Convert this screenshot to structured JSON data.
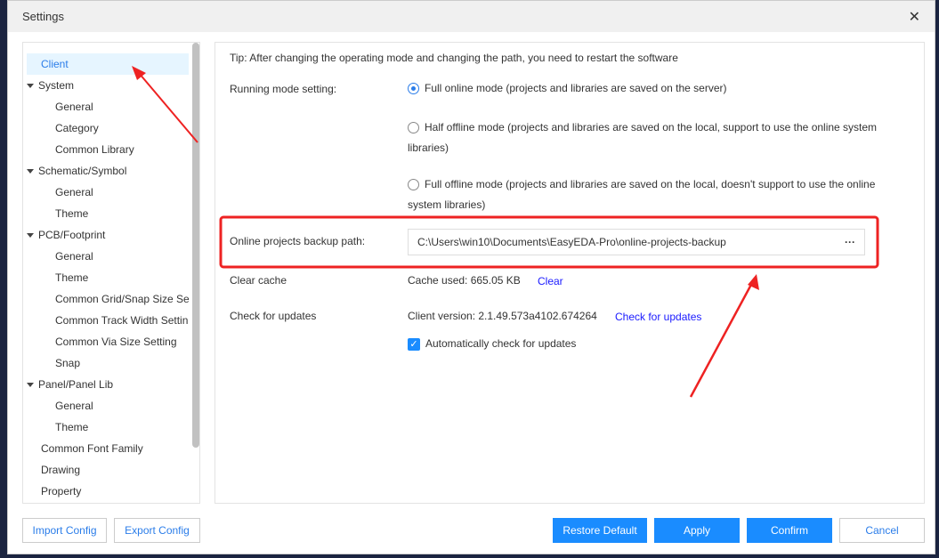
{
  "window": {
    "title": "Settings",
    "close_icon": "close-icon"
  },
  "tree": [
    {
      "label": "Client",
      "level": 0,
      "selected": true
    },
    {
      "label": "System",
      "level": 1
    },
    {
      "label": "General",
      "level": 2
    },
    {
      "label": "Category",
      "level": 2
    },
    {
      "label": "Common Library",
      "level": 2
    },
    {
      "label": "Schematic/Symbol",
      "level": 1
    },
    {
      "label": "General",
      "level": 2
    },
    {
      "label": "Theme",
      "level": 2
    },
    {
      "label": "PCB/Footprint",
      "level": 1
    },
    {
      "label": "General",
      "level": 2
    },
    {
      "label": "Theme",
      "level": 2
    },
    {
      "label": "Common Grid/Snap Size Se",
      "level": 2
    },
    {
      "label": "Common Track Width Settin",
      "level": 2
    },
    {
      "label": "Common Via Size Setting",
      "level": 2
    },
    {
      "label": "Snap",
      "level": 2
    },
    {
      "label": "Panel/Panel Lib",
      "level": 1
    },
    {
      "label": "General",
      "level": 2
    },
    {
      "label": "Theme",
      "level": 2
    },
    {
      "label": "Common Font Family",
      "level": 0
    },
    {
      "label": "Drawing",
      "level": 0
    },
    {
      "label": "Property",
      "level": 0
    }
  ],
  "main": {
    "tip": "Tip: After changing the operating mode and changing the path, you need to restart the software",
    "running_mode_label": "Running mode setting:",
    "mode_full_online": "Full online mode (projects and libraries are saved on the server)",
    "mode_half_offline_1": "Half offline mode (projects and libraries are saved on the local, support to use the online system",
    "mode_half_offline_2": "libraries)",
    "mode_full_offline_1": "Full offline mode (projects and libraries are saved on the local, doesn't support to use the online",
    "mode_full_offline_2": "system libraries)",
    "selected_mode": "Full online mode",
    "backup_label": "Online projects backup path:",
    "backup_path": "C:\\Users\\win10\\Documents\\EasyEDA-Pro\\online-projects-backup",
    "backup_browse": "···",
    "cache_label": "Clear cache",
    "cache_used": "Cache used: 665.05 KB",
    "clear_link": "Clear",
    "updates_label": "Check for updates",
    "client_version": "Client version: 2.1.49.573a4102.674264",
    "check_link": "Check for updates",
    "auto_check_label": "Automatically check for updates",
    "auto_check": true
  },
  "buttons": {
    "import": "Import Config",
    "export": "Export Config",
    "restore": "Restore Default",
    "apply": "Apply",
    "confirm": "Confirm",
    "cancel": "Cancel"
  },
  "colors": {
    "accent": "#1a8cff",
    "annotation": "#ee2222"
  }
}
